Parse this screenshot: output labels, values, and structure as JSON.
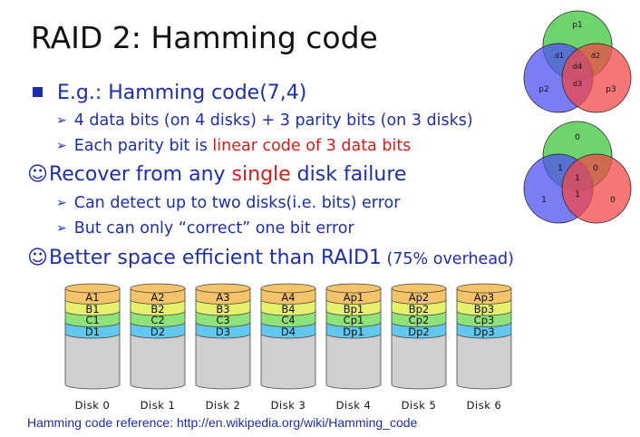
{
  "slide": {
    "title": "RAID 2: Hamming code",
    "bullet_1": "E.g.: Hamming code(7,4)",
    "sub_1a": "4 data bits (on 4 disks) + 3 parity bits (on 3 disks)",
    "sub_1b_pre": "Each parity bit is ",
    "sub_1b_red": "linear code of 3 data bits",
    "bullet_2_pre": "Recover from any ",
    "bullet_2_red": "single",
    "bullet_2_post": " disk failure",
    "sub_2a": "Can detect up to two disks(i.e. bits) error",
    "sub_2b": "But can only “correct” one bit error",
    "bullet_3": "Better space efficient than RAID1",
    "bullet_3_small": " (75% overhead)",
    "smile_glyph": "☺",
    "arrow_glyph": "➢",
    "reference": "Hamming code reference: http://en.wikipedia.org/wiki/Hamming_code"
  },
  "venn_top": {
    "p1": "p1",
    "p2": "p2",
    "p3": "p3",
    "d1": "d1",
    "d2": "d2",
    "d3": "d3",
    "d4": "d4"
  },
  "venn_bottom": {
    "p1": "0",
    "p2": "1",
    "p3": "0",
    "d1": "1",
    "d2": "0",
    "d3": "1",
    "d4": "1"
  },
  "disks": [
    {
      "name": "Disk 0",
      "rows": [
        "A1",
        "B1",
        "C1",
        "D1"
      ]
    },
    {
      "name": "Disk 1",
      "rows": [
        "A2",
        "B2",
        "C2",
        "D2"
      ]
    },
    {
      "name": "Disk 2",
      "rows": [
        "A3",
        "B3",
        "C3",
        "D3"
      ]
    },
    {
      "name": "Disk 3",
      "rows": [
        "A4",
        "B4",
        "C4",
        "D4"
      ]
    },
    {
      "name": "Disk 4",
      "rows": [
        "Ap1",
        "Bp1",
        "Cp1",
        "Dp1"
      ]
    },
    {
      "name": "Disk 5",
      "rows": [
        "Ap2",
        "Bp2",
        "Cp2",
        "Dp2"
      ]
    },
    {
      "name": "Disk 6",
      "rows": [
        "Ap3",
        "Bp3",
        "Cp3",
        "Dp3"
      ]
    }
  ],
  "colors": {
    "text": "#1d2ea8",
    "red": "#d81c1c",
    "row_a": "#f5c36a",
    "row_b": "#e6ef6e",
    "row_c": "#8fe27a",
    "row_d": "#62c7ec",
    "disk_body": "#cfcfcf",
    "venn_green": "#3ec63e",
    "venn_blue": "#5050f0",
    "venn_red": "#f04848"
  }
}
